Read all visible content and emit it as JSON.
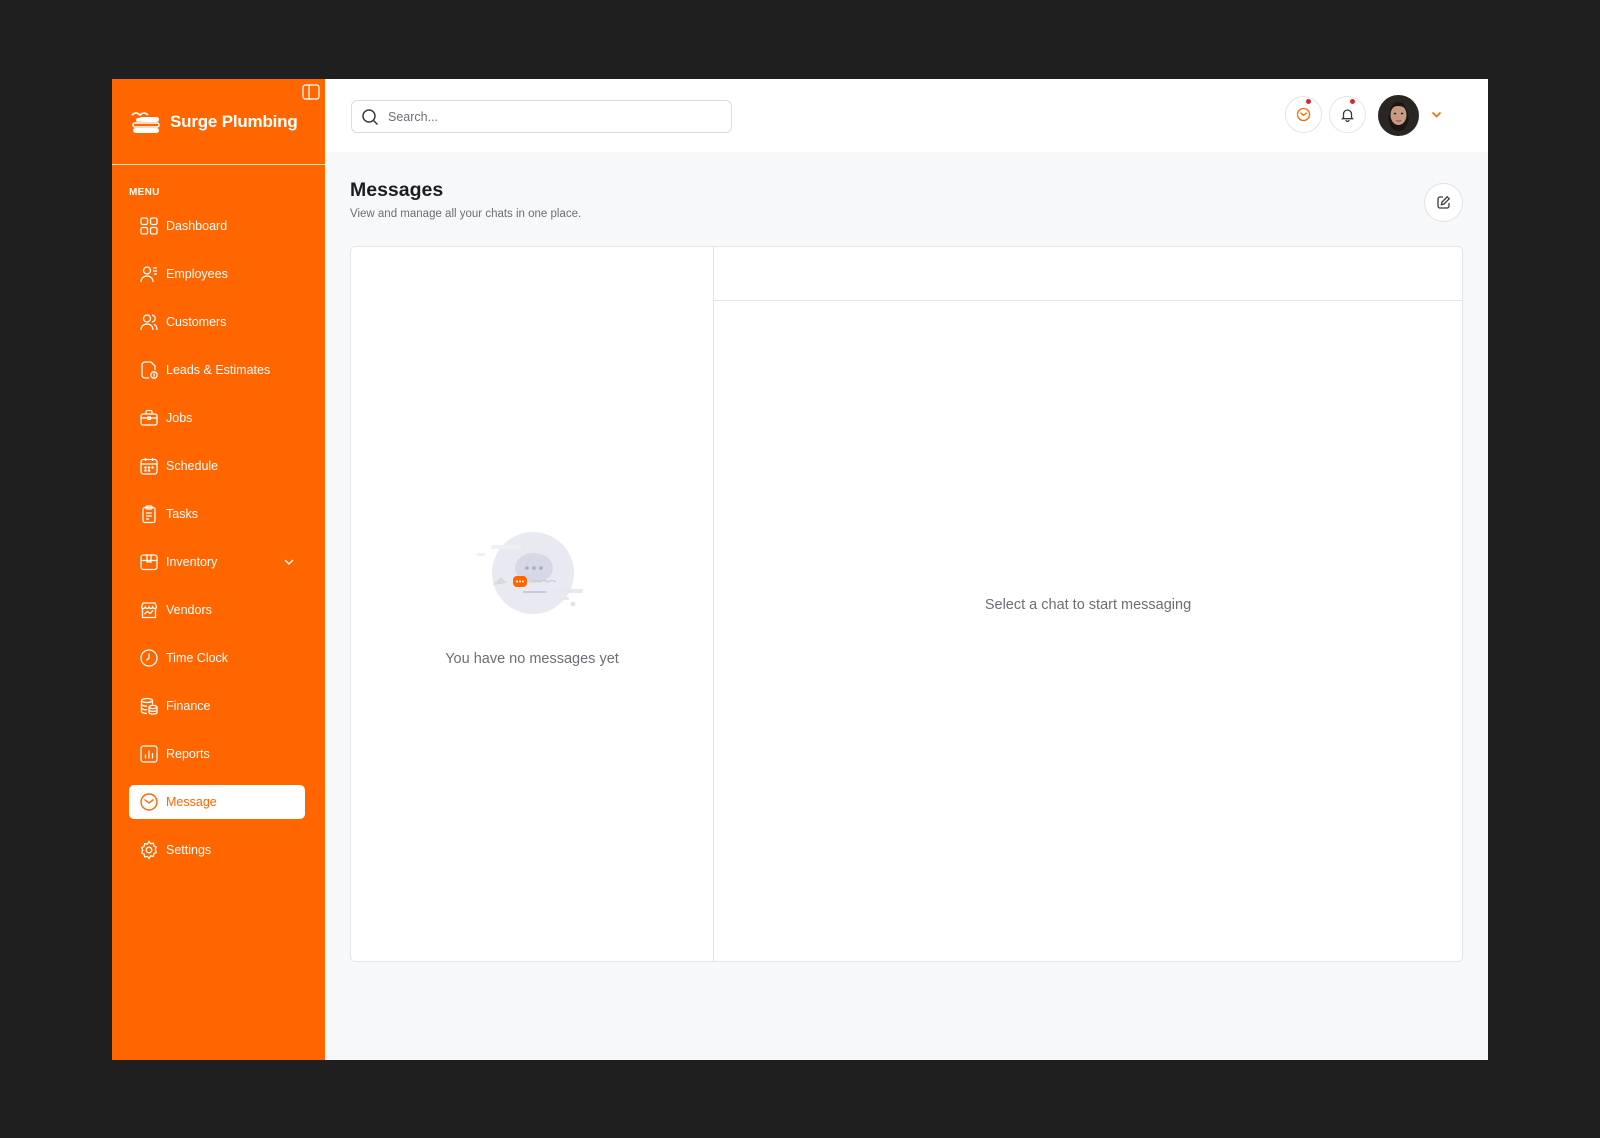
{
  "brand": {
    "name": "Surge Plumbing"
  },
  "sidebar": {
    "menu_title": "MENU",
    "items": [
      {
        "label": "Dashboard",
        "icon": "grid-icon"
      },
      {
        "label": "Employees",
        "icon": "employees-icon"
      },
      {
        "label": "Customers",
        "icon": "customers-icon"
      },
      {
        "label": "Leads & Estimates",
        "icon": "document-dollar-icon"
      },
      {
        "label": "Jobs",
        "icon": "briefcase-icon"
      },
      {
        "label": "Schedule",
        "icon": "calendar-icon"
      },
      {
        "label": "Tasks",
        "icon": "clipboard-icon"
      },
      {
        "label": "Inventory",
        "icon": "box-icon",
        "expandable": true
      },
      {
        "label": "Vendors",
        "icon": "store-icon"
      },
      {
        "label": "Time Clock",
        "icon": "clock-icon"
      },
      {
        "label": "Finance",
        "icon": "coins-icon"
      },
      {
        "label": "Reports",
        "icon": "chart-icon"
      },
      {
        "label": "Message",
        "icon": "message-icon",
        "active": true
      },
      {
        "label": "Settings",
        "icon": "gear-icon"
      }
    ]
  },
  "header": {
    "search_placeholder": "Search...",
    "messages_badge": "",
    "notifications_badge": ""
  },
  "page": {
    "title": "Messages",
    "subtitle": "View and manage all your chats in one place."
  },
  "chat_list": {
    "empty_text": "You have no messages yet"
  },
  "chat_pane": {
    "hint": "Select a chat to start messaging"
  },
  "colors": {
    "brand": "#ff6600",
    "badge": "#e0242c",
    "text_muted": "#6b6e76"
  }
}
